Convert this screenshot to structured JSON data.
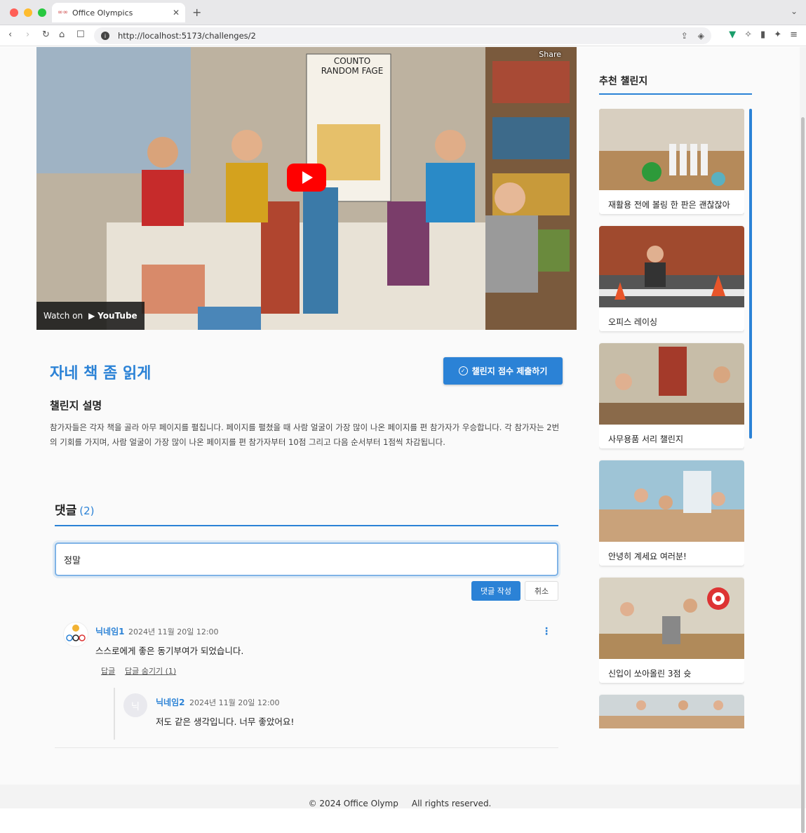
{
  "browser": {
    "tab_title": "Office Olympics",
    "url": "http://localhost:5173/challenges/2"
  },
  "video": {
    "share_label": "Share",
    "watch_label": "Watch on",
    "youtube_label": "YouTube",
    "poster_text_line1": "COUNTO",
    "poster_text_line2": "RANDOM FAGE"
  },
  "challenge": {
    "title": "자네 책 좀 읽게",
    "submit_label": "챌린지 점수 제출하기",
    "description_heading": "챌린지 설명",
    "description": "참가자들은 각자 책을 골라 아무 페이지를 펼칩니다. 페이지를 펼쳤을 때 사람 얼굴이 가장 많이 나온 페이지를 편 참가자가 우승합니다. 각 참가자는 2번의 기회를 가지며, 사람 얼굴이 가장 많이 나온 페이지를 편 참가자부터 10점 그리고 다음 순서부터 1점씩 차감됩니다."
  },
  "comments": {
    "heading": "댓글",
    "count": "(2)",
    "input_value": "정말",
    "write_label": "댓글 작성",
    "cancel_label": "취소",
    "items": [
      {
        "name": "닉네임1",
        "date": "2024년 11월 20일 12:00",
        "text": "스스로에게 좋은 동기부여가 되었습니다.",
        "reply_label": "답글",
        "hide_label": "답글 숨기기 (1)",
        "replies": [
          {
            "avatar_initial": "닉",
            "name": "닉네임2",
            "date": "2024년 11월 20일 12:00",
            "text": "저도 같은 생각입니다. 너무 좋았어요!"
          }
        ]
      }
    ]
  },
  "sidebar": {
    "heading": "추천 챌린지",
    "items": [
      {
        "label": "재활용 전에 볼링 한 판은 괜찮잖아"
      },
      {
        "label": "오피스 레이싱"
      },
      {
        "label": "사무용품 서리 챌린지"
      },
      {
        "label": "안녕히 계세요 여러분!"
      },
      {
        "label": "신입이 쏘아올린 3점 슛"
      },
      {
        "label": ""
      }
    ]
  },
  "footer": {
    "text": "© 2024 Office Olymp     All rights reserved."
  }
}
